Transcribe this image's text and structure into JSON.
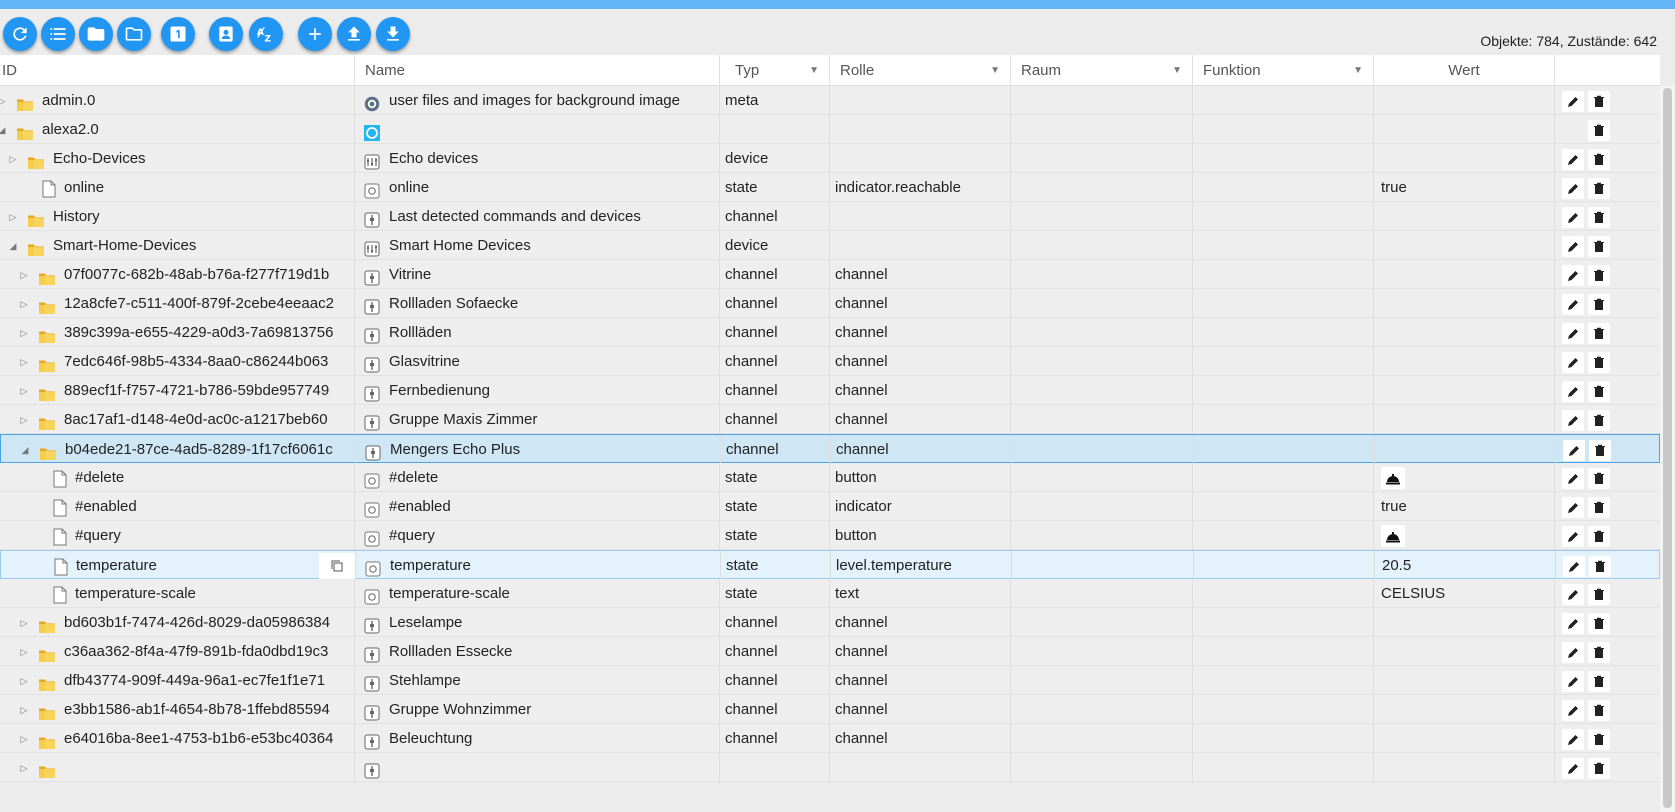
{
  "toolbar": {
    "buttons": [
      "refresh-icon",
      "list-icon",
      "folder-icon",
      "folder-outline-icon",
      "one-icon",
      "contact-icon",
      "sort-az-icon",
      "add-icon",
      "upload-icon",
      "download-icon"
    ],
    "counts": "Objekte: 784, Zustände: 642"
  },
  "columns": {
    "id": "ID",
    "name": "Name",
    "typ": "Typ",
    "rolle": "Rolle",
    "raum": "Raum",
    "funktion": "Funktion",
    "wert": "Wert"
  },
  "colors": {
    "accent": "#2196f3",
    "selected": "#cfe6f5",
    "folder": "#f2c230"
  },
  "rows": [
    {
      "id": "admin.0",
      "name": "user files and images for background image",
      "typ": "meta",
      "rolle": "",
      "wert": "",
      "level": 0,
      "kind": "folder",
      "expander": "collapsed",
      "nameIcon": "gear-icon",
      "edit": true
    },
    {
      "id": "alexa2.0",
      "name": "",
      "typ": "",
      "rolle": "",
      "wert": "",
      "level": 0,
      "kind": "folder",
      "expander": "expanded",
      "nameIcon": "alexa-icon",
      "edit": false
    },
    {
      "id": "Echo-Devices",
      "name": "Echo devices",
      "typ": "device",
      "rolle": "",
      "wert": "",
      "level": 1,
      "kind": "folder",
      "expander": "collapsed",
      "nameIcon": "device-icon",
      "edit": true
    },
    {
      "id": "online",
      "name": "online",
      "typ": "state",
      "rolle": "indicator.reachable",
      "wert": "true",
      "level": 2,
      "kind": "file",
      "expander": "none",
      "nameIcon": "state-icon",
      "edit": true
    },
    {
      "id": "History",
      "name": "Last detected commands and devices",
      "typ": "channel",
      "rolle": "",
      "wert": "",
      "level": 1,
      "kind": "folder",
      "expander": "collapsed",
      "nameIcon": "channel-icon",
      "edit": true
    },
    {
      "id": "Smart-Home-Devices",
      "name": "Smart Home Devices",
      "typ": "device",
      "rolle": "",
      "wert": "",
      "level": 1,
      "kind": "folder",
      "expander": "expanded",
      "nameIcon": "device-icon",
      "edit": true
    },
    {
      "id": "07f0077c-682b-48ab-b76a-f277f719d1b",
      "name": "Vitrine",
      "typ": "channel",
      "rolle": "channel",
      "wert": "",
      "level": 2,
      "kind": "folder",
      "expander": "collapsed",
      "nameIcon": "channel-icon",
      "edit": true
    },
    {
      "id": "12a8cfe7-c511-400f-879f-2cebe4eeaac2",
      "name": "Rollladen Sofaecke",
      "typ": "channel",
      "rolle": "channel",
      "wert": "",
      "level": 2,
      "kind": "folder",
      "expander": "collapsed",
      "nameIcon": "channel-icon",
      "edit": true
    },
    {
      "id": "389c399a-e655-4229-a0d3-7a69813756",
      "name": "Rollläden",
      "typ": "channel",
      "rolle": "channel",
      "wert": "",
      "level": 2,
      "kind": "folder",
      "expander": "collapsed",
      "nameIcon": "channel-icon",
      "edit": true
    },
    {
      "id": "7edc646f-98b5-4334-8aa0-c86244b063",
      "name": "Glasvitrine",
      "typ": "channel",
      "rolle": "channel",
      "wert": "",
      "level": 2,
      "kind": "folder",
      "expander": "collapsed",
      "nameIcon": "channel-icon",
      "edit": true
    },
    {
      "id": "889ecf1f-f757-4721-b786-59bde957749",
      "name": "Fernbedienung",
      "typ": "channel",
      "rolle": "channel",
      "wert": "",
      "level": 2,
      "kind": "folder",
      "expander": "collapsed",
      "nameIcon": "channel-icon",
      "edit": true
    },
    {
      "id": "8ac17af1-d148-4e0d-ac0c-a1217beb60",
      "name": "Gruppe Maxis Zimmer",
      "typ": "channel",
      "rolle": "channel",
      "wert": "",
      "level": 2,
      "kind": "folder",
      "expander": "collapsed",
      "nameIcon": "channel-icon",
      "edit": true
    },
    {
      "id": "b04ede21-87ce-4ad5-8289-1f17cf6061c",
      "name": "Mengers Echo Plus",
      "typ": "channel",
      "rolle": "channel",
      "wert": "",
      "level": 2,
      "kind": "folder",
      "expander": "expanded",
      "nameIcon": "channel-icon",
      "edit": true,
      "state": "selected"
    },
    {
      "id": "#delete",
      "name": "#delete",
      "typ": "state",
      "rolle": "button",
      "wert": "",
      "level": 3,
      "kind": "file",
      "expander": "none",
      "nameIcon": "state-icon",
      "edit": true,
      "wertIcon": "bell-icon"
    },
    {
      "id": "#enabled",
      "name": "#enabled",
      "typ": "state",
      "rolle": "indicator",
      "wert": "true",
      "level": 3,
      "kind": "file",
      "expander": "none",
      "nameIcon": "state-icon",
      "edit": true
    },
    {
      "id": "#query",
      "name": "#query",
      "typ": "state",
      "rolle": "button",
      "wert": "",
      "level": 3,
      "kind": "file",
      "expander": "none",
      "nameIcon": "state-icon",
      "edit": true,
      "wertIcon": "bell-icon"
    },
    {
      "id": "temperature",
      "name": "temperature",
      "typ": "state",
      "rolle": "level.temperature",
      "wert": "20.5",
      "level": 3,
      "kind": "file",
      "expander": "none",
      "nameIcon": "state-icon",
      "edit": true,
      "state": "hover",
      "copy": true
    },
    {
      "id": "temperature-scale",
      "name": "temperature-scale",
      "typ": "state",
      "rolle": "text",
      "wert": "CELSIUS",
      "level": 3,
      "kind": "file",
      "expander": "none",
      "nameIcon": "state-icon",
      "edit": true
    },
    {
      "id": "bd603b1f-7474-426d-8029-da05986384",
      "name": "Leselampe",
      "typ": "channel",
      "rolle": "channel",
      "wert": "",
      "level": 2,
      "kind": "folder",
      "expander": "collapsed",
      "nameIcon": "channel-icon",
      "edit": true
    },
    {
      "id": "c36aa362-8f4a-47f9-891b-fda0dbd19c3",
      "name": "Rollladen Essecke",
      "typ": "channel",
      "rolle": "channel",
      "wert": "",
      "level": 2,
      "kind": "folder",
      "expander": "collapsed",
      "nameIcon": "channel-icon",
      "edit": true
    },
    {
      "id": "dfb43774-909f-449a-96a1-ec7fe1f1e71",
      "name": "Stehlampe",
      "typ": "channel",
      "rolle": "channel",
      "wert": "",
      "level": 2,
      "kind": "folder",
      "expander": "collapsed",
      "nameIcon": "channel-icon",
      "edit": true
    },
    {
      "id": "e3bb1586-ab1f-4654-8b78-1ffebd85594",
      "name": "Gruppe Wohnzimmer",
      "typ": "channel",
      "rolle": "channel",
      "wert": "",
      "level": 2,
      "kind": "folder",
      "expander": "collapsed",
      "nameIcon": "channel-icon",
      "edit": true
    },
    {
      "id": "e64016ba-8ee1-4753-b1b6-e53bc40364",
      "name": "Beleuchtung",
      "typ": "channel",
      "rolle": "channel",
      "wert": "",
      "level": 2,
      "kind": "folder",
      "expander": "collapsed",
      "nameIcon": "channel-icon",
      "edit": true
    },
    {
      "id": "",
      "name": "",
      "typ": "",
      "rolle": "",
      "wert": "",
      "level": 2,
      "kind": "folder",
      "expander": "collapsed",
      "nameIcon": "channel-icon",
      "edit": true
    }
  ]
}
